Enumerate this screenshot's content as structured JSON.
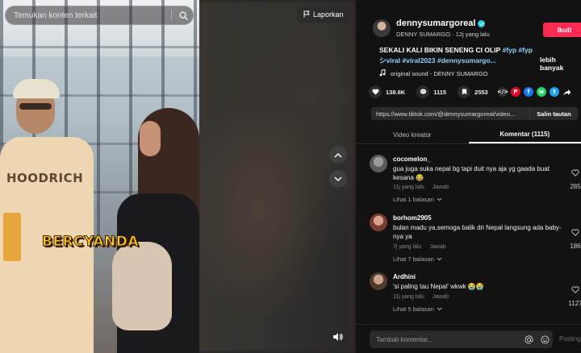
{
  "search": {
    "placeholder": "Temukan konten terkait"
  },
  "video": {
    "report_label": "Laporkan",
    "caption_overlay": "BERCYANDA",
    "shirt_text": "HOODRICH"
  },
  "author": {
    "username": "dennysumargoreal",
    "display_name": "DENNY SUMARGO",
    "time_ago": "12j yang lalu",
    "follow_label": "Ikuti"
  },
  "description": {
    "text": "SEKALI KALI BIKIN SENENG CI OLIP",
    "hashtags": [
      "#fyp",
      "#fypシviral",
      "#viral2023",
      "#dennysumargo..."
    ],
    "more_label": "lebih banyak"
  },
  "sound": {
    "label": "original sound - DENNY SUMARGO"
  },
  "stats": {
    "likes": "138.6K",
    "comments": "1115",
    "saves": "2553"
  },
  "share_icons": [
    "embed-icon",
    "pinterest-icon",
    "facebook-icon",
    "whatsapp-icon",
    "twitter-icon",
    "share-arrow-icon"
  ],
  "share_link": {
    "url": "https://www.tiktok.com/@dennysumargoreal/video...",
    "copy_label": "Salin tautan"
  },
  "tabs": [
    {
      "label": "Video kreator",
      "active": false
    },
    {
      "label": "Komentar (1115)",
      "active": true
    }
  ],
  "comments": [
    {
      "user": "cocomelon_",
      "text": "gua juga suka nepal bg tapi duit nya aja yg gaada buat kesana 😂",
      "time": "11j yang lalu",
      "reply_label": "Jawab",
      "replies": "Lihat 1 balasan",
      "likes": "285"
    },
    {
      "user": "borhom2905",
      "text": "bulan madu ya,semoga balik dri Nepal langsung ada baby-nya ya",
      "time": "7j yang lalu",
      "reply_label": "Jawab",
      "replies": "Lihat 7 balasan",
      "likes": "186"
    },
    {
      "user": "Ardhini",
      "text": "'si paling tau Nepal' wkwk 😭😭",
      "time": "11j yang lalu",
      "reply_label": "Jawab",
      "replies": "Lihat 5 balasan",
      "likes": "1127"
    }
  ],
  "comment_box": {
    "placeholder": "Tambah komentar...",
    "post_label": "Posting"
  },
  "colors": {
    "follow_red": "#fe2c55",
    "hashtag_blue": "#8fd3ff",
    "verified_cyan": "#20d5ec",
    "panel_bg": "#121212"
  }
}
